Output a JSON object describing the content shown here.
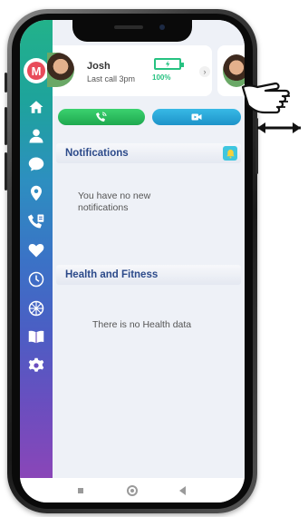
{
  "app": {
    "logo_letter": "M",
    "brand_color": "#e84b5a"
  },
  "sidebar": {
    "items": [
      {
        "icon": "home-icon"
      },
      {
        "icon": "person-icon"
      },
      {
        "icon": "chat-icon"
      },
      {
        "icon": "location-pin-icon"
      },
      {
        "icon": "phone-contacts-icon"
      },
      {
        "icon": "heart-icon"
      },
      {
        "icon": "clock-icon"
      },
      {
        "icon": "compass-icon"
      },
      {
        "icon": "book-icon"
      },
      {
        "icon": "gear-icon"
      }
    ]
  },
  "contact": {
    "name": "Josh",
    "last_call": "Last call 3pm",
    "battery_percent": "100%",
    "battery_color": "#26c281"
  },
  "actions": {
    "call_color": "#27b85a",
    "video_color": "#27a5d8"
  },
  "notifications": {
    "title": "Notifications",
    "empty": "You have no new notifications"
  },
  "health": {
    "title": "Health and Fitness",
    "empty": "There is no Health data"
  }
}
